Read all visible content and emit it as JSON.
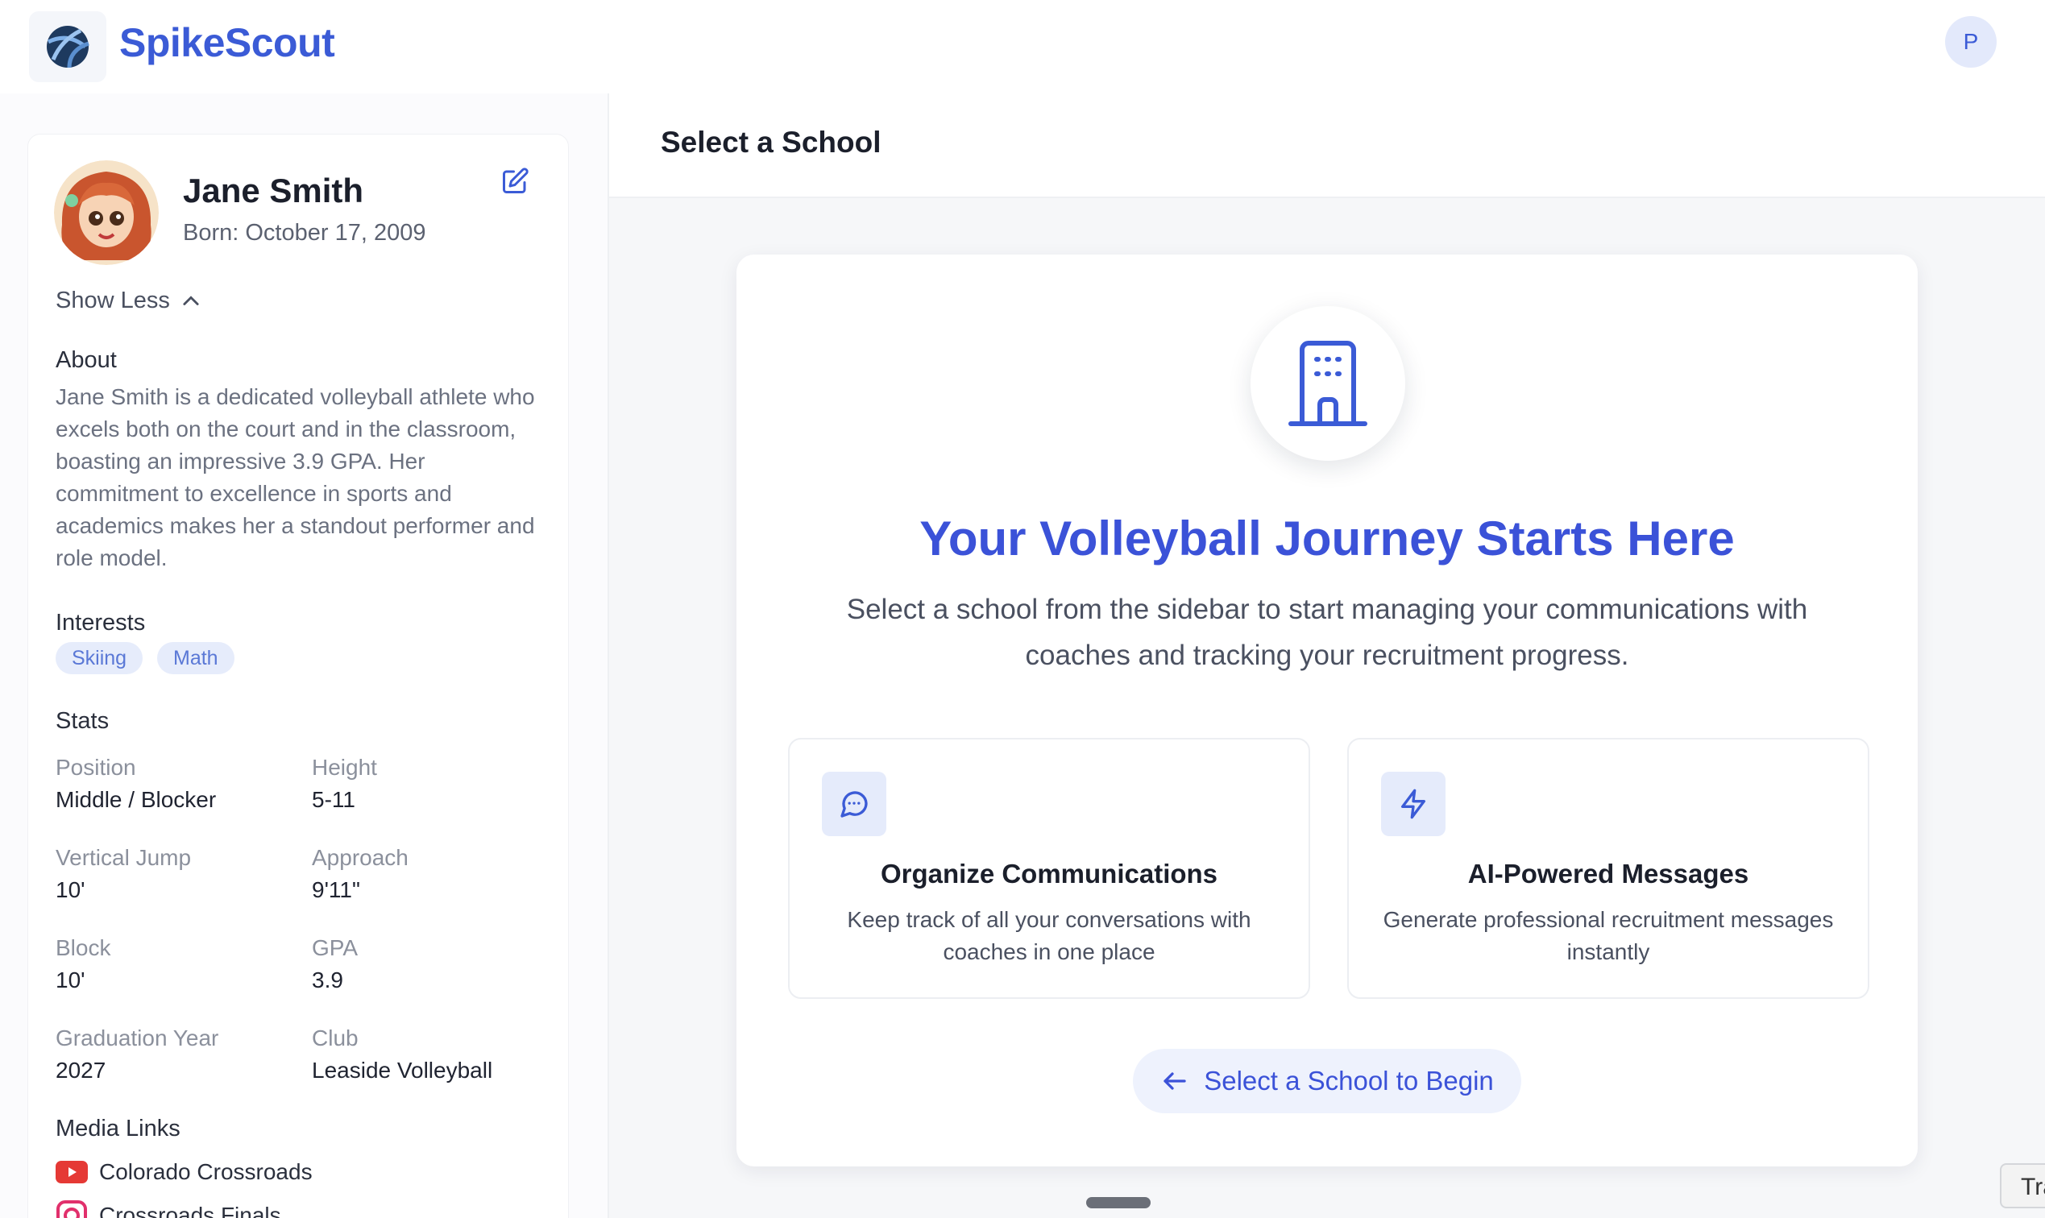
{
  "app": {
    "brand": "SpikeScout",
    "user_initial": "P"
  },
  "profile": {
    "name": "Jane Smith",
    "born": "Born: October 17, 2009",
    "toggle_label": "Show Less",
    "about_title": "About",
    "about_text": "Jane Smith is a dedicated volleyball athlete who excels both on the court and in the classroom, boasting an impressive 3.9 GPA. Her commitment to excellence in sports and academics makes her a standout performer and role model.",
    "interests_title": "Interests",
    "interests": [
      "Skiing",
      "Math"
    ],
    "stats_title": "Stats",
    "stats": [
      {
        "label": "Position",
        "value": "Middle / Blocker"
      },
      {
        "label": "Height",
        "value": "5-11"
      },
      {
        "label": "Vertical Jump",
        "value": "10'"
      },
      {
        "label": "Approach",
        "value": "9'11\""
      },
      {
        "label": "Block",
        "value": "10'"
      },
      {
        "label": "GPA",
        "value": "3.9"
      },
      {
        "label": "Graduation Year",
        "value": "2027"
      },
      {
        "label": "Club",
        "value": "Leaside Volleyball"
      }
    ],
    "media_title": "Media Links",
    "media_links": [
      {
        "label": "Colorado Crossroads",
        "icon": "youtube-icon"
      },
      {
        "label": "Crossroads Finals",
        "icon": "instagram-icon"
      }
    ]
  },
  "main": {
    "header_title": "Select a School",
    "hero_title": "Your Volleyball Journey Starts Here",
    "hero_subtitle": "Select a school from the sidebar to start managing your communications with coaches and tracking your recruitment progress.",
    "features": [
      {
        "title": "Organize Communications",
        "description": "Keep track of all your conversations with coaches in one place",
        "icon": "chat-icon"
      },
      {
        "title": "AI-Powered Messages",
        "description": "Generate professional recruitment messages instantly",
        "icon": "lightning-icon"
      }
    ],
    "cta_label": "Select a School to Begin"
  },
  "translate_tab": "Tra",
  "colors": {
    "accent": "#3b52d8",
    "brand": "#3b5bd6",
    "chip_bg": "#e6ecfb"
  }
}
